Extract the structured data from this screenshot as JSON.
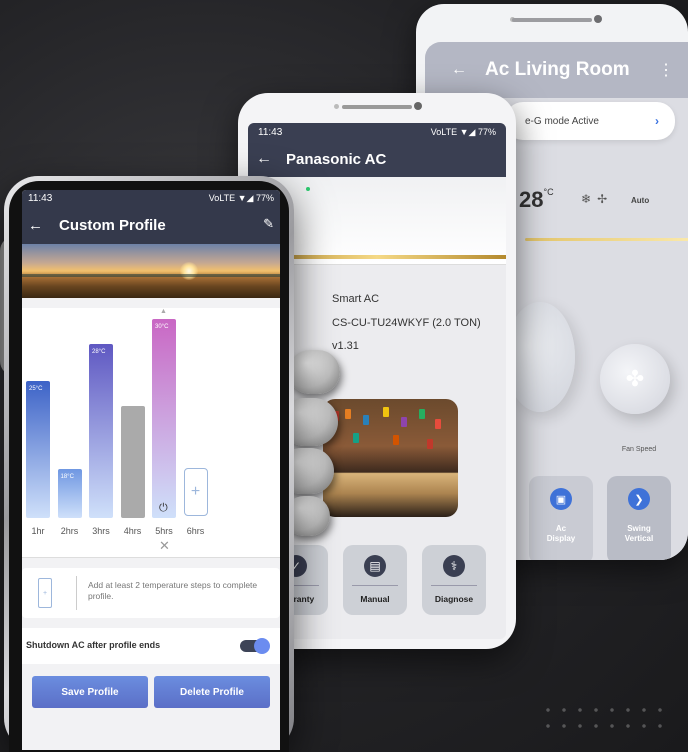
{
  "back_screen": {
    "title": "Ac Living Room",
    "mode_text": "e-G mode Active",
    "temperature": "28",
    "temp_unit": "°C",
    "fan_mode": "Auto",
    "fan_speed_label": "Fan Speed",
    "tiles": [
      {
        "label": "Ac\nDisplay",
        "icon": "display-icon"
      },
      {
        "label": "Swing\nVertical",
        "icon": "swing-icon"
      }
    ]
  },
  "middle_screen": {
    "status_time": "11:43",
    "status_right": "VoLTE ▼◢ 77%",
    "title": "Panasonic AC",
    "brand": "Panasonic",
    "device_type": "Smart AC",
    "model": "CS-CU-TU24WKYF (2.0 TON)",
    "version": "v1.31",
    "tiles": [
      {
        "label": "Warranty",
        "icon": "warranty-icon"
      },
      {
        "label": "Manual",
        "icon": "manual-icon"
      },
      {
        "label": "Diagnose",
        "icon": "diagnose-icon"
      }
    ]
  },
  "front_screen": {
    "status_time": "11:43",
    "status_right": "VoLTE ▼◢ 77%",
    "title": "Custom Profile",
    "hint_text": "Add at least 2 temperature steps to complete profile.",
    "shutdown_label": "Shutdown AC after profile ends",
    "shutdown_enabled": true,
    "save_label": "Save Profile",
    "delete_label": "Delete Profile",
    "accent_color": "#5b6fc7"
  },
  "chart_data": {
    "type": "bar",
    "categories": [
      "1hr",
      "2hrs",
      "3hrs",
      "4hrs",
      "5hrs",
      "6hrs"
    ],
    "values": [
      25,
      18,
      28,
      null,
      30,
      null
    ],
    "labels": [
      "25°C",
      "18°C",
      "28°C",
      "",
      "30°C",
      ""
    ],
    "colors": [
      "#3d63c7",
      "#6f97e2",
      "#5f58c2",
      "#aaaaaa",
      "#c967c4",
      ""
    ],
    "ylabel": "",
    "xlabel": ""
  }
}
